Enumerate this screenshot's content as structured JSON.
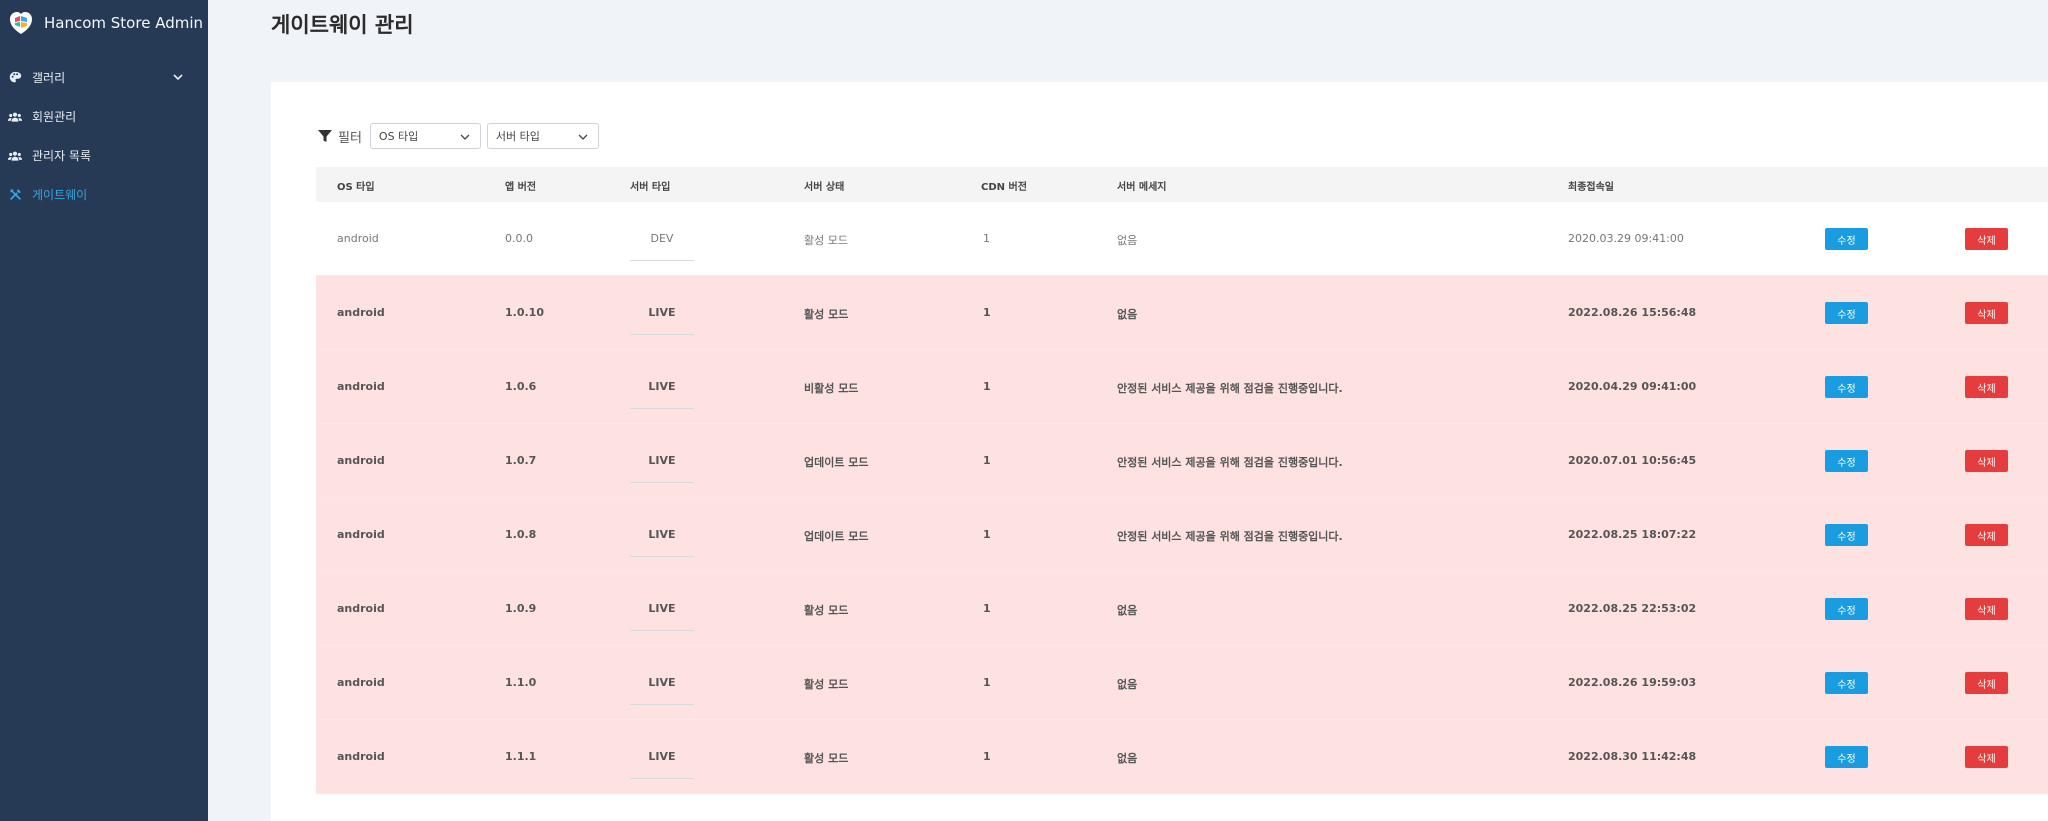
{
  "sidebar": {
    "brand": "Hancom Store Admin",
    "items": [
      {
        "label": "갤러리",
        "icon": "palette-icon",
        "has_children": true
      },
      {
        "label": "회원관리",
        "icon": "users-icon"
      },
      {
        "label": "관리자 목록",
        "icon": "admins-icon"
      },
      {
        "label": "게이트웨이",
        "icon": "tools-icon",
        "active": true
      }
    ]
  },
  "page": {
    "title": "게이트웨이 관리"
  },
  "filter": {
    "label": "필터",
    "os_select": "OS 타입",
    "server_select": "서버 타입"
  },
  "table": {
    "headers": [
      "OS 타입",
      "앱 버전",
      "서버 타입",
      "서버 상태",
      "CDN 버전",
      "서버 메세지",
      "최종접속일"
    ],
    "edit_label": "수정",
    "delete_label": "삭제",
    "rows": [
      {
        "os": "android",
        "version": "0.0.0",
        "server": "DEV",
        "status": "활성 모드",
        "cdn": "1",
        "message": "없음",
        "last": "2020.03.29 09:41:00"
      },
      {
        "os": "android",
        "version": "1.0.10",
        "server": "LIVE",
        "status": "활성 모드",
        "cdn": "1",
        "message": "없음",
        "last": "2022.08.26 15:56:48"
      },
      {
        "os": "android",
        "version": "1.0.6",
        "server": "LIVE",
        "status": "비활성 모드",
        "cdn": "1",
        "message": "안정된 서비스 제공을 위해 점검을 진행중입니다.",
        "last": "2020.04.29 09:41:00"
      },
      {
        "os": "android",
        "version": "1.0.7",
        "server": "LIVE",
        "status": "업데이트 모드",
        "cdn": "1",
        "message": "안정된 서비스 제공을 위해 점검을 진행중입니다.",
        "last": "2020.07.01 10:56:45"
      },
      {
        "os": "android",
        "version": "1.0.8",
        "server": "LIVE",
        "status": "업데이트 모드",
        "cdn": "1",
        "message": "안정된 서비스 제공을 위해 점검을 진행중입니다.",
        "last": "2022.08.25 18:07:22"
      },
      {
        "os": "android",
        "version": "1.0.9",
        "server": "LIVE",
        "status": "활성 모드",
        "cdn": "1",
        "message": "없음",
        "last": "2022.08.25 22:53:02"
      },
      {
        "os": "android",
        "version": "1.1.0",
        "server": "LIVE",
        "status": "활성 모드",
        "cdn": "1",
        "message": "없음",
        "last": "2022.08.26 19:59:03"
      },
      {
        "os": "android",
        "version": "1.1.1",
        "server": "LIVE",
        "status": "활성 모드",
        "cdn": "1",
        "message": "없음",
        "last": "2022.08.30 11:42:48"
      }
    ]
  },
  "colors": {
    "sidebar_bg": "#263a55",
    "active_menu": "#3ca3e0",
    "live_row_bg": "#fee2e2",
    "edit_button": "#1a9ce0",
    "delete_button": "#e53d3d"
  }
}
